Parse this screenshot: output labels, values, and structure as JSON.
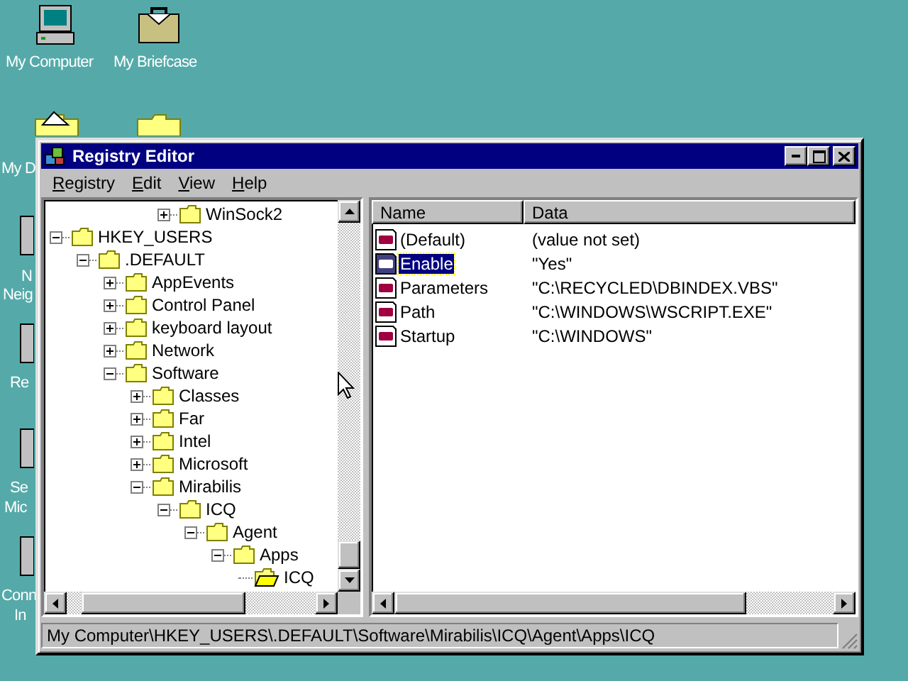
{
  "desktop_icons": [
    {
      "kind": "computer",
      "label_lines": [
        "My Computer"
      ]
    },
    {
      "kind": "briefcase",
      "label_lines": [
        "My Briefcase"
      ]
    },
    {
      "kind": "documents",
      "label_lines": [
        "My D"
      ]
    },
    {
      "kind": "folder"
    },
    {
      "kind": "network",
      "label_lines": [
        "N",
        "Neig"
      ]
    },
    {
      "kind": "recycle",
      "label_lines": [
        "Re"
      ]
    },
    {
      "kind": "msn",
      "label_lines": [
        "Se",
        "Mic"
      ]
    },
    {
      "kind": "connect",
      "label_lines": [
        "Conn",
        "In"
      ]
    }
  ],
  "window": {
    "title": "Registry Editor"
  },
  "menu": [
    "Registry",
    "Edit",
    "View",
    "Help"
  ],
  "tree": {
    "top_item": {
      "label": "WinSock2",
      "kind": "node",
      "expanded": false,
      "selected": false
    },
    "items": [
      {
        "label": "HKEY_USERS",
        "kind": "node",
        "expanded": true,
        "selected": false,
        "children": [
          {
            "label": ".DEFAULT",
            "kind": "node",
            "expanded": true,
            "selected": false,
            "children": [
              {
                "label": "AppEvents",
                "kind": "node",
                "expanded": false,
                "selected": false
              },
              {
                "label": "Control Panel",
                "kind": "node",
                "expanded": false,
                "selected": false
              },
              {
                "label": "keyboard layout",
                "kind": "node",
                "expanded": false,
                "selected": false
              },
              {
                "label": "Network",
                "kind": "node",
                "expanded": false,
                "selected": false
              },
              {
                "label": "Software",
                "kind": "node",
                "expanded": true,
                "selected": false,
                "children": [
                  {
                    "label": "Classes",
                    "kind": "node",
                    "expanded": false,
                    "selected": false
                  },
                  {
                    "label": "Far",
                    "kind": "node",
                    "expanded": false,
                    "selected": false
                  },
                  {
                    "label": "Intel",
                    "kind": "node",
                    "expanded": false,
                    "selected": false
                  },
                  {
                    "label": "Microsoft",
                    "kind": "node",
                    "expanded": false,
                    "selected": false
                  },
                  {
                    "label": "Mirabilis",
                    "kind": "node",
                    "expanded": true,
                    "selected": false,
                    "children": [
                      {
                        "label": "ICQ",
                        "kind": "node",
                        "expanded": true,
                        "selected": false,
                        "children": [
                          {
                            "label": "Agent",
                            "kind": "node",
                            "expanded": true,
                            "selected": false,
                            "children": [
                              {
                                "label": "Apps",
                                "kind": "node",
                                "expanded": true,
                                "selected": false,
                                "children": [
                                  {
                                    "label": "ICQ",
                                    "kind": "leaf",
                                    "selected": true
                                  }
                                ]
                              }
                            ]
                          }
                        ]
                      }
                    ]
                  }
                ]
              }
            ]
          }
        ]
      }
    ]
  },
  "list": {
    "columns": [
      "Name",
      "Data"
    ],
    "rows": [
      {
        "name": "(Default)",
        "data": "(value not set)",
        "selected": false
      },
      {
        "name": "Enable",
        "data": "\"Yes\"",
        "selected": true
      },
      {
        "name": "Parameters",
        "data": "\"C:\\RECYCLED\\DBINDEX.VBS\"",
        "selected": false
      },
      {
        "name": "Path",
        "data": "\"C:\\WINDOWS\\WSCRIPT.EXE\"",
        "selected": false
      },
      {
        "name": "Startup",
        "data": "\"C:\\WINDOWS\"",
        "selected": false
      }
    ]
  },
  "status_bar": "My Computer\\HKEY_USERS\\.DEFAULT\\Software\\Mirabilis\\ICQ\\Agent\\Apps\\ICQ"
}
